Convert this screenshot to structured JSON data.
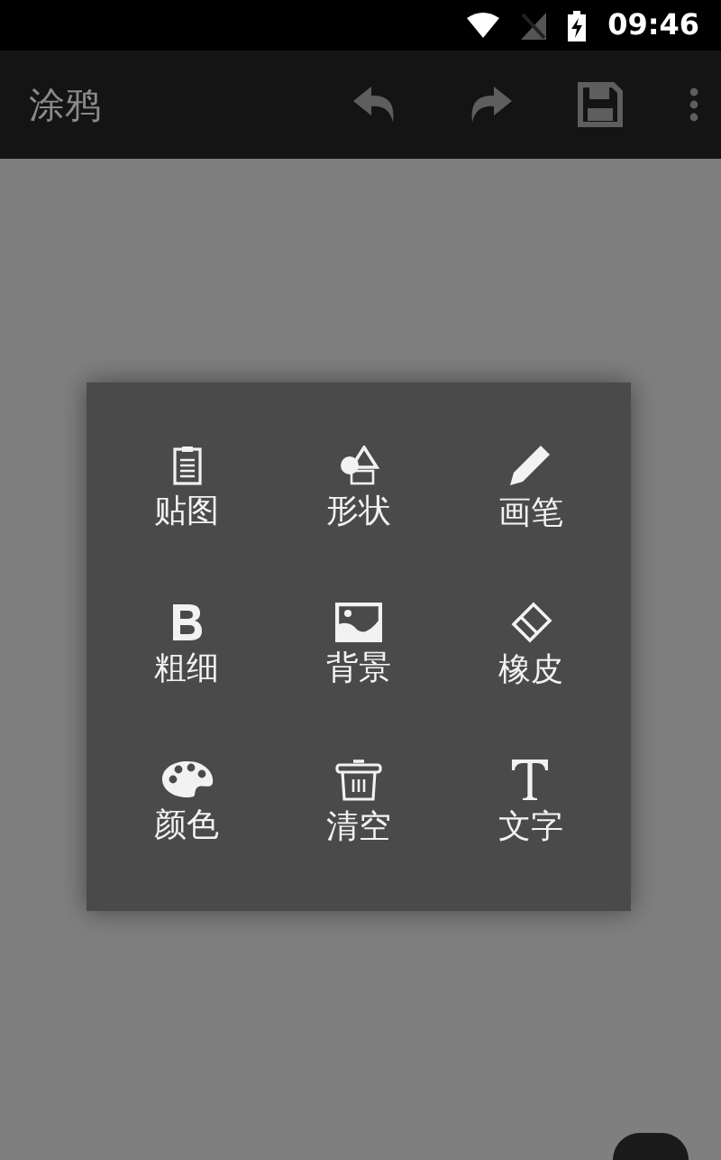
{
  "status_bar": {
    "time": "09:46"
  },
  "toolbar": {
    "title": "涂鸦"
  },
  "tools": [
    {
      "kind": "sticker",
      "label": "贴图"
    },
    {
      "kind": "shape",
      "label": "形状"
    },
    {
      "kind": "brush",
      "label": "画笔"
    },
    {
      "kind": "bold",
      "label": "粗细"
    },
    {
      "kind": "background",
      "label": "背景"
    },
    {
      "kind": "eraser",
      "label": "橡皮"
    },
    {
      "kind": "palette",
      "label": "颜色"
    },
    {
      "kind": "clear",
      "label": "清空"
    },
    {
      "kind": "text",
      "label": "文字"
    }
  ]
}
